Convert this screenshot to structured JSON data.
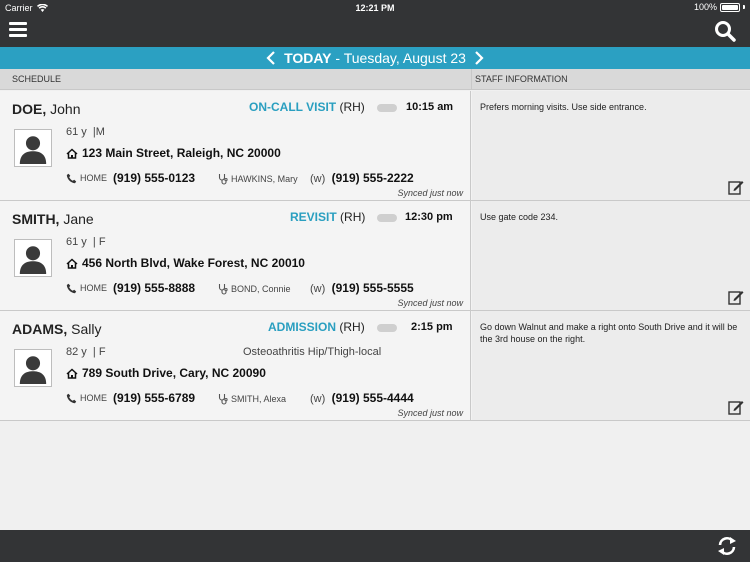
{
  "status": {
    "carrier": "Carrier",
    "time": "12:21 PM",
    "battery": "100%",
    "battery_level": 1.0
  },
  "toolbar": {
    "menu_icon": "hamburger-icon",
    "search_icon": "search-icon"
  },
  "date_nav": {
    "today": "TODAY",
    "separator": " - ",
    "date": "Tuesday, August 23"
  },
  "headers": {
    "schedule": "SCHEDULE",
    "staff_info": "STAFF INFORMATION"
  },
  "visits": [
    {
      "last_name": "DOE,",
      "first_name": "John",
      "visit_type": "ON-CALL VISIT",
      "visit_code": "(RH)",
      "time": "10:15 am",
      "age": "61 y",
      "gender": "|M",
      "diagnosis": "",
      "address": "123 Main Street, Raleigh, NC 20000",
      "home_label": "HOME",
      "home_phone": "(919) 555-0123",
      "clinician": "HAWKINS, Mary",
      "work_label": "(w)",
      "work_phone": "(919) 555-2222",
      "synced": "Synced just now",
      "staff_info": "Prefers morning visits. Use side entrance."
    },
    {
      "last_name": "SMITH,",
      "first_name": "Jane",
      "visit_type": "REVISIT",
      "visit_code": "(RH)",
      "time": "12:30 pm",
      "age": "61 y",
      "gender": "| F",
      "diagnosis": "",
      "address": "456 North Blvd, Wake Forest, NC 20010",
      "home_label": "HOME",
      "home_phone": "(919) 555-8888",
      "clinician": "BOND, Connie",
      "work_label": "(w)",
      "work_phone": "(919) 555-5555",
      "synced": "Synced just now",
      "staff_info": "Use gate code 234."
    },
    {
      "last_name": "ADAMS,",
      "first_name": "Sally",
      "visit_type": "ADMISSION",
      "visit_code": "(RH)",
      "time": "2:15 pm",
      "age": "82 y",
      "gender": "| F",
      "diagnosis": "Osteoathritis Hip/Thigh-local",
      "address": "789 South Drive, Cary, NC 20090",
      "home_label": "HOME",
      "home_phone": "(919) 555-6789",
      "clinician": "SMITH, Alexa",
      "work_label": "(w)",
      "work_phone": "(919) 555-4444",
      "synced": "Synced just now",
      "staff_info": "Go down Walnut and make a right onto South Drive and it will be the 3rd house on the right."
    }
  ],
  "colors": {
    "accent": "#2ba0c2",
    "bar": "#333436"
  }
}
